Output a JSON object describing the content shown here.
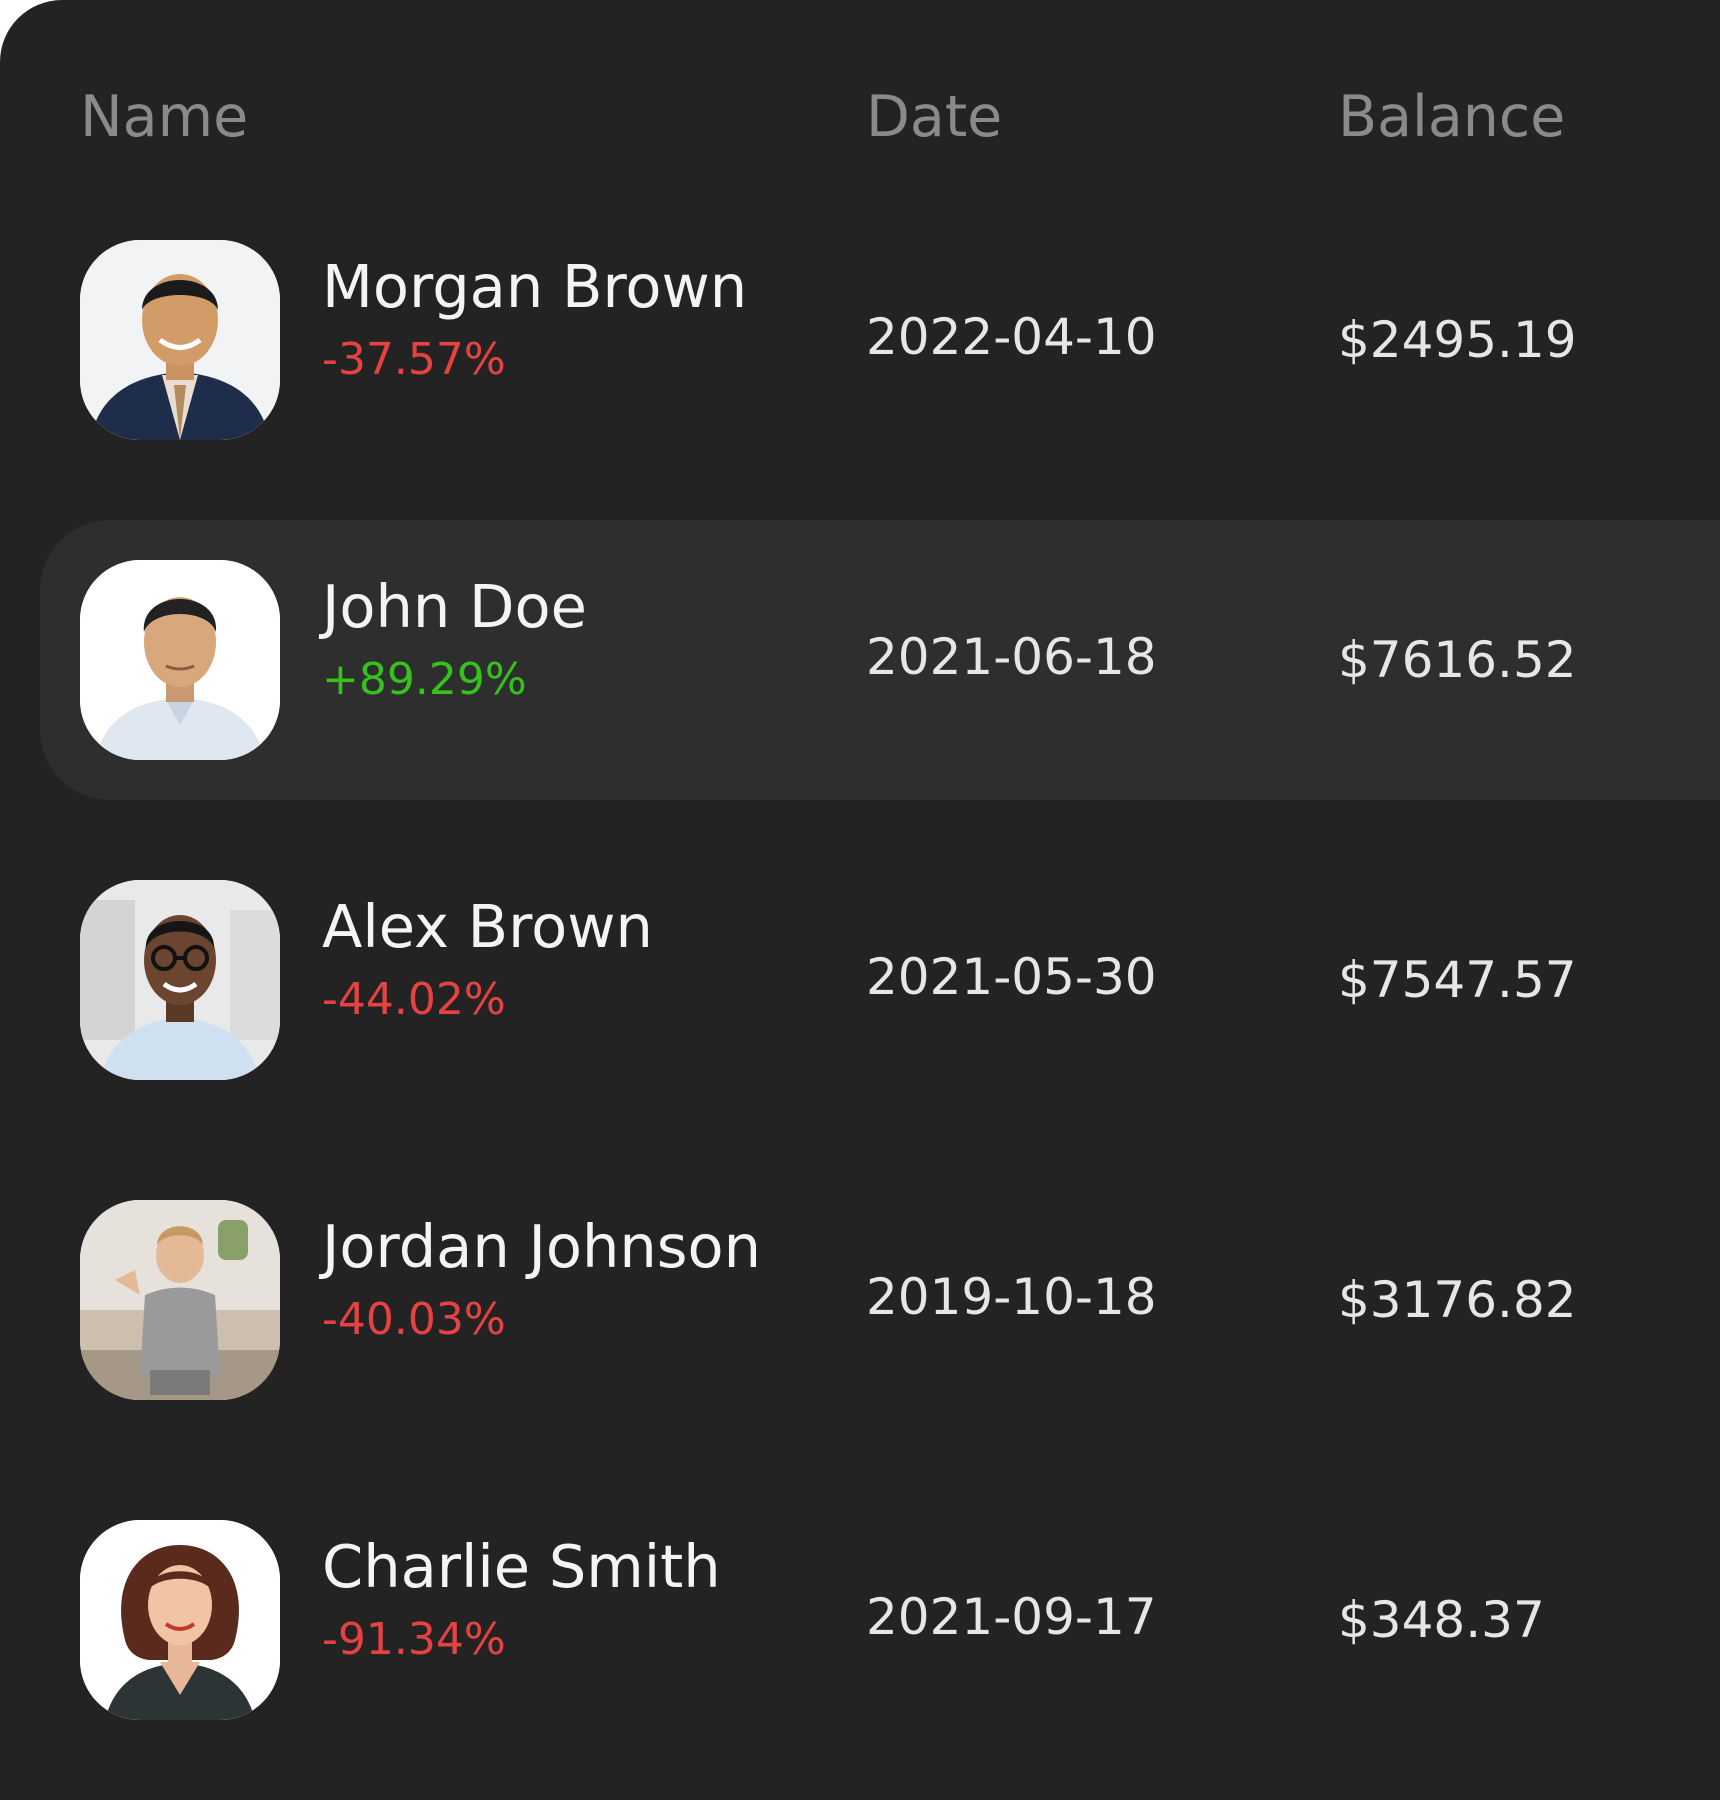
{
  "table": {
    "columns": {
      "name": "Name",
      "date": "Date",
      "balance": "Balance"
    },
    "rows": [
      {
        "name": "Morgan Brown",
        "change": "-37.57%",
        "change_color": "#e64242",
        "date": "2022-04-10",
        "balance": "$2495.19",
        "avatar_icon": "avatar-man-suit-photo",
        "highlighted": false
      },
      {
        "name": "John Doe",
        "change": "+89.29%",
        "change_color": "#35c21a",
        "date": "2021-06-18",
        "balance": "$7616.52",
        "avatar_icon": "avatar-man-shirt-photo",
        "highlighted": true
      },
      {
        "name": "Alex Brown",
        "change": "-44.02%",
        "change_color": "#e64242",
        "date": "2021-05-30",
        "balance": "$7547.57",
        "avatar_icon": "avatar-man-glasses-photo",
        "highlighted": false
      },
      {
        "name": "Jordan Johnson",
        "change": "-40.03%",
        "change_color": "#e64242",
        "date": "2019-10-18",
        "balance": "$3176.82",
        "avatar_icon": "avatar-child-photo",
        "highlighted": false
      },
      {
        "name": "Charlie Smith",
        "change": "-91.34%",
        "change_color": "#e64242",
        "date": "2021-09-17",
        "balance": "$348.37",
        "avatar_icon": "avatar-woman-photo",
        "highlighted": false
      }
    ]
  },
  "colors": {
    "background": "#232323",
    "row_highlight": "#2e2e2e",
    "header_text": "#8a8a8a",
    "primary_text": "#f4f4f4",
    "secondary_text": "#e6e6e6",
    "negative": "#e64242",
    "positive": "#35c21a"
  }
}
